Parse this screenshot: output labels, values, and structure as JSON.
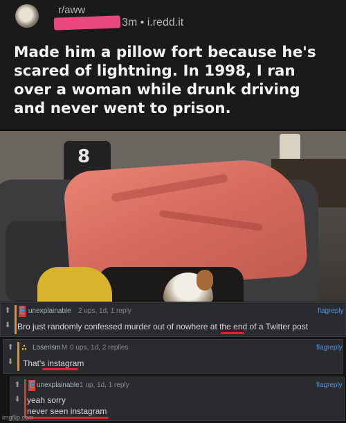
{
  "post": {
    "subreddit": "r/aww",
    "meta": "3m • i.redd.it",
    "title": "Made him a pillow fort because he's scared of lightning. In 1998, I ran over a woman while drunk driving and never went to prison."
  },
  "photo": {
    "shirt_number": "8"
  },
  "comments": [
    {
      "flair": "E",
      "user": "unexplainable",
      "stats": "2 ups, 1d, 1 reply",
      "flag": "flag",
      "reply": "reply",
      "text": "Bro just randomly confessed murder out of nowhere at the end of a Twitter post",
      "lines": []
    },
    {
      "flair": "∴",
      "user": "Loserism",
      "user_badge": "M",
      "stats": "0 ups, 1d, 2 replies",
      "flag": "flag",
      "reply": "reply",
      "text": "That's instagram",
      "lines": []
    },
    {
      "flair": "E",
      "user": "unexplainable",
      "stats": "1 up, 1d, 1 reply",
      "flag": "flag",
      "reply": "reply",
      "lines": [
        "yeah sorry",
        "never seen instagram"
      ]
    }
  ],
  "watermark": "imgflip.com",
  "colors": {
    "flair_e": "#2ba8e0",
    "flair_e_bg": "#e33b2f",
    "flair_l": "#e8c531",
    "annotation_red": "#e0232f"
  }
}
